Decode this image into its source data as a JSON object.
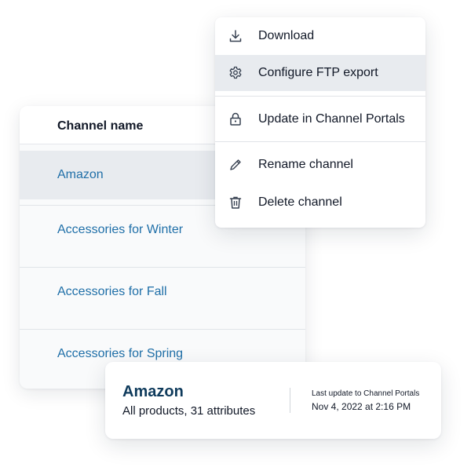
{
  "table": {
    "column_header": "Channel name",
    "rows": [
      {
        "label": "Amazon"
      },
      {
        "label": "Accessories for Winter"
      },
      {
        "label": "Accessories for Fall"
      },
      {
        "label": "Accessories for Spring"
      }
    ]
  },
  "menu": {
    "items": [
      {
        "label": "Download",
        "icon": "download-icon"
      },
      {
        "label": "Configure FTP export",
        "icon": "gear-icon"
      },
      {
        "label": "Update in Channel Portals",
        "icon": "lock-icon"
      },
      {
        "label": "Rename channel",
        "icon": "pencil-icon"
      },
      {
        "label": "Delete channel",
        "icon": "trash-icon"
      }
    ]
  },
  "detail": {
    "title": "Amazon",
    "subtitle": "All products, 31 attributes",
    "meta_label": "Last update to Channel Portals",
    "meta_value": "Nov 4, 2022 at 2:16 PM"
  },
  "colors": {
    "link": "#1f6fa8",
    "title_dark": "#0f3b5c",
    "highlight": "#e8ebef"
  }
}
